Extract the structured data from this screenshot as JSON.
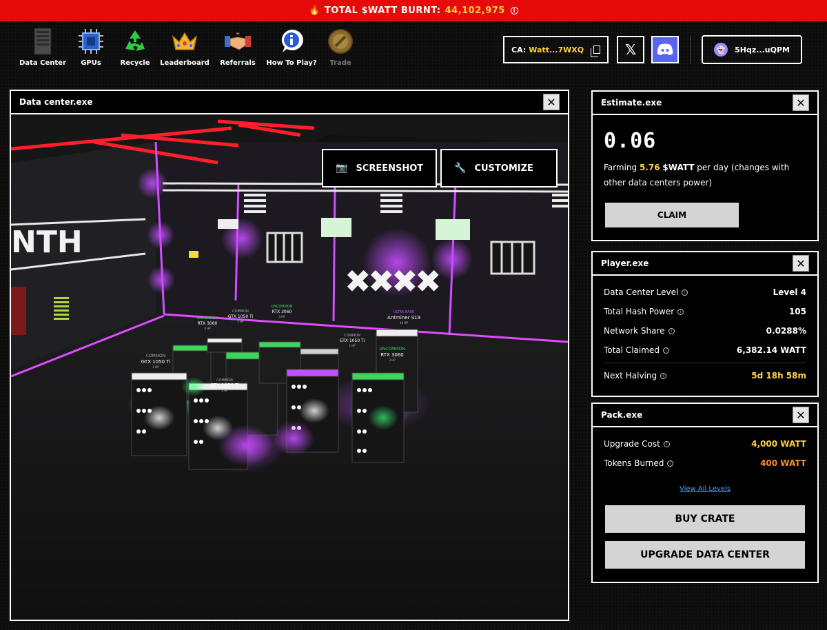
{
  "banner": {
    "label": "TOTAL $WATT BURNT:",
    "value": "44,102,975"
  },
  "nav": [
    {
      "label": "Data Center",
      "icon": "server-icon"
    },
    {
      "label": "GPUs",
      "icon": "chip-icon"
    },
    {
      "label": "Recycle",
      "icon": "recycle-icon"
    },
    {
      "label": "Leaderboard",
      "icon": "crown-icon"
    },
    {
      "label": "Referrals",
      "icon": "handshake-icon"
    },
    {
      "label": "How To Play?",
      "icon": "info-icon"
    },
    {
      "label": "Trade",
      "icon": "coin-icon"
    }
  ],
  "header": {
    "ca_label": "CA:",
    "ca_value": "Watt...7WXQ",
    "x_label": "𝕏",
    "wallet": "5Hqz...uQPM"
  },
  "datacenter": {
    "title": "Data center.exe",
    "screenshot_label": "SCREENSHOT",
    "customize_label": "CUSTOMIZE",
    "wall_text": "NTH",
    "rigs": [
      {
        "rarity": "COMMON",
        "name": "GTX 1050 Ti",
        "hp": "1 HP"
      },
      {
        "rarity": "UNCOMMON",
        "name": "RTX 3060",
        "hp": "3 HP"
      },
      {
        "rarity": "COMMON",
        "name": "GTX 1050 Ti",
        "hp": "1 HP"
      },
      {
        "rarity": "UNCOMMON",
        "name": "RTX 3060",
        "hp": "3 HP"
      },
      {
        "rarity": "COMMON",
        "name": "GTX 1050 Ti",
        "hp": "1 HP"
      },
      {
        "rarity": "UNCOMMON",
        "name": "RTX 3060",
        "hp": "3 HP"
      },
      {
        "rarity": "COMMON",
        "name": "GTX 1050 Ti",
        "hp": "1 HP"
      },
      {
        "rarity": "ULTRA RARE",
        "name": "Antminer S19",
        "hp": "40 HP"
      }
    ]
  },
  "estimate": {
    "title": "Estimate.exe",
    "amount": "0.06",
    "farming_prefix": "Farming",
    "farming_value": "5.76",
    "farming_unit": "$WATT",
    "farming_suffix": "per day (changes with other data centers power)",
    "claim_label": "CLAIM"
  },
  "player": {
    "title": "Player.exe",
    "rows": [
      {
        "label": "Data Center Level",
        "value": "Level 4"
      },
      {
        "label": "Total Hash Power",
        "value": "105"
      },
      {
        "label": "Network Share",
        "value": "0.0288%"
      },
      {
        "label": "Total Claimed",
        "value": "6,382.14 WATT"
      }
    ],
    "halving_label": "Next Halving",
    "halving_value": "5d 18h 58m"
  },
  "pack": {
    "title": "Pack.exe",
    "upgrade_label": "Upgrade Cost",
    "upgrade_value": "4,000 WATT",
    "burned_label": "Tokens Burned",
    "burned_value": "400 WATT",
    "view_levels": "View All Levels",
    "buy_label": "BUY CRATE",
    "upgrade_btn": "UPGRADE DATA CENTER"
  },
  "colors": {
    "banner": "#e60a0a",
    "yellow": "#ffd43b",
    "orange": "#ff8a2a",
    "purple": "#b23cff",
    "green": "#29d65a"
  }
}
